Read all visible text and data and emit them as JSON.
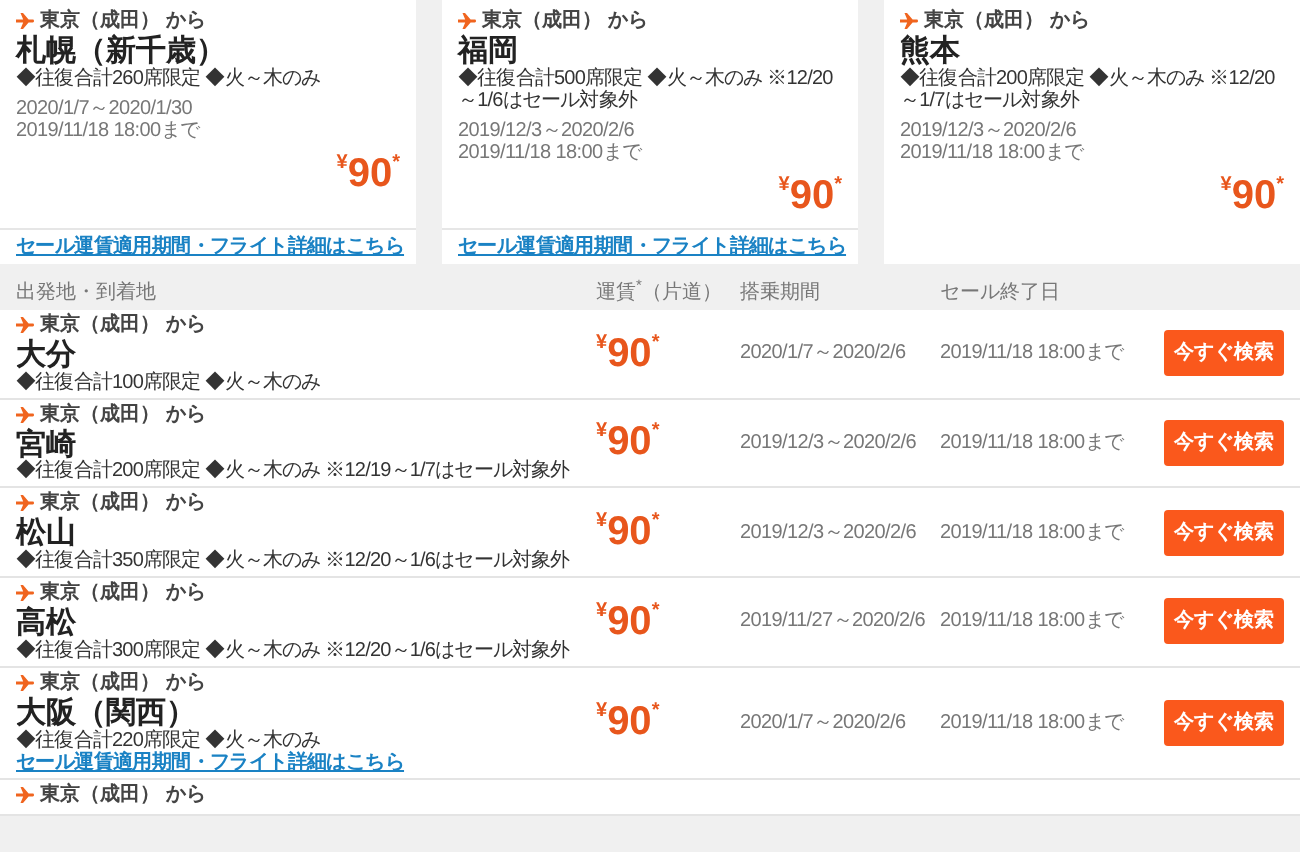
{
  "featured": [
    {
      "from": "東京（成田） から",
      "city": "札幌（新千歳）",
      "note": "◆往復合計260席限定 ◆火～木のみ",
      "period": "2020/1/7～2020/1/30",
      "sale_end": "2019/11/18 18:00まで",
      "price": "$^{¥}$90$^{*}$",
      "link": "セール運賃適用期間・フライト詳細はこちら"
    },
    {
      "from": "東京（成田） から",
      "city": "福岡",
      "note": "◆往復合計500席限定 ◆火～木のみ ※12/20～1/6はセール対象外",
      "period": "2019/12/3～2020/2/6",
      "sale_end": "2019/11/18 18:00まで",
      "price": "$^{¥}$90$^{*}$",
      "link": "セール運賃適用期間・フライト詳細はこちら"
    },
    {
      "from": "東京（成田） から",
      "city": "熊本",
      "note": "◆往復合計200席限定 ◆火～木のみ ※12/20～1/7はセール対象外",
      "period": "2019/12/3～2020/2/6",
      "sale_end": "2019/11/18 18:00まで",
      "price": "$^{¥}$90$^{*}$"
    }
  ],
  "table": {
    "columns": [
      "出発地・到着地",
      "運賃$^{*}$（片道）",
      "搭乗期間",
      "セール終了日"
    ],
    "rows": [
      {
        "from": "東京（成田） から",
        "city": "大分",
        "note": "◆往復合計100席限定 ◆火～木のみ",
        "price": "$^{¥}$90$^{*}$",
        "period": "2020/1/7～2020/2/6",
        "sale_end": "2019/11/18 18:00まで",
        "button": "今すぐ検索"
      },
      {
        "from": "東京（成田） から",
        "city": "宮崎",
        "note": "◆往復合計200席限定 ◆火～木のみ ※12/19～1/7はセール対象外",
        "price": "$^{¥}$90$^{*}$",
        "period": "2019/12/3～2020/2/6",
        "sale_end": "2019/11/18 18:00まで",
        "button": "今すぐ検索"
      },
      {
        "from": "東京（成田） から",
        "city": "松山",
        "note": "◆往復合計350席限定 ◆火～木のみ ※12/20～1/6はセール対象外",
        "price": "$^{¥}$90$^{*}$",
        "period": "2019/12/3～2020/2/6",
        "sale_end": "2019/11/18 18:00まで",
        "button": "今すぐ検索"
      },
      {
        "from": "東京（成田） から",
        "city": "高松",
        "note": "◆往復合計300席限定 ◆火～木のみ ※12/20～1/6はセール対象外",
        "price": "$^{¥}$90$^{*}$",
        "period": "2019/11/27～2020/2/6",
        "sale_end": "2019/11/18 18:00まで",
        "button": "今すぐ検索"
      },
      {
        "from": "東京（成田） から",
        "city": "大阪（関西）",
        "note": "◆往復合計220席限定 ◆火～木のみ",
        "price": "$^{¥}$90$^{*}$",
        "period": "2020/1/7～2020/2/6",
        "sale_end": "2019/11/18 18:00まで",
        "button": "今すぐ検索",
        "link": "セール運賃適用期間・フライト詳細はこちら"
      },
      {
        "from": "東京（成田） から"
      }
    ]
  }
}
